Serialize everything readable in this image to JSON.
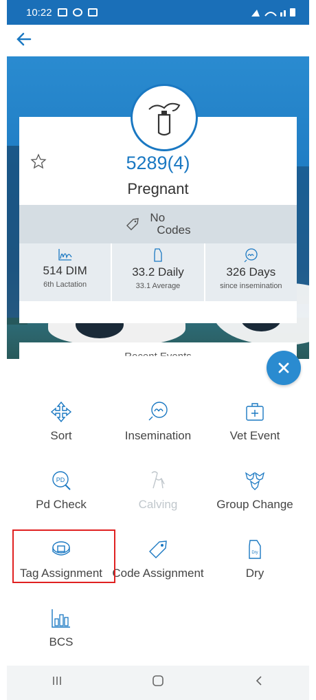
{
  "status_bar": {
    "time": "10:22",
    "right_icons": "wifi-signal-battery"
  },
  "app_bar": {
    "back_icon": "arrow-left-icon"
  },
  "cow": {
    "id": "5289",
    "lactation_suffix": "(4)",
    "status": "Pregnant",
    "codes_line1": "No",
    "codes_line2": "Codes"
  },
  "stats": [
    {
      "main": "514 DIM",
      "sub": "6th Lactation"
    },
    {
      "main": "33.2 Daily",
      "sub": "33.1 Average"
    },
    {
      "main": "326 Days",
      "sub": "since insemination"
    }
  ],
  "recent_label": "Recent Events",
  "actions": [
    {
      "label": "Sort",
      "enabled": true
    },
    {
      "label": "Insemination",
      "enabled": true
    },
    {
      "label": "Vet Event",
      "enabled": true
    },
    {
      "label": "Pd Check",
      "enabled": true
    },
    {
      "label": "Calving",
      "enabled": false
    },
    {
      "label": "Group Change",
      "enabled": true
    },
    {
      "label": "Tag Assignment",
      "enabled": true
    },
    {
      "label": "Code Assignment",
      "enabled": true
    },
    {
      "label": "Dry",
      "enabled": true
    },
    {
      "label": "BCS",
      "enabled": true
    }
  ],
  "colors": {
    "accent": "#1a78c2",
    "highlight": "#e02020"
  }
}
